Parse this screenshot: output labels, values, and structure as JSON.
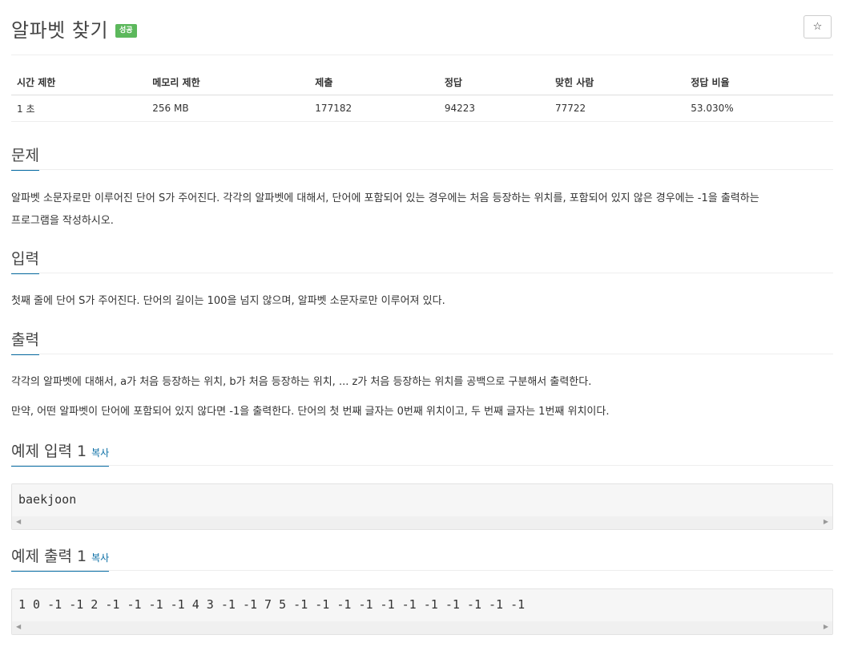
{
  "problem": {
    "title": "알파벳 찾기",
    "status_badge": "성공",
    "star_icon": "☆"
  },
  "stats": {
    "headers": [
      "시간 제한",
      "메모리 제한",
      "제출",
      "정답",
      "맞힌 사람",
      "정답 비율"
    ],
    "values": [
      "1 초",
      "256 MB",
      "177182",
      "94223",
      "77722",
      "53.030%"
    ]
  },
  "sections": {
    "description": {
      "title": "문제",
      "lines": [
        "알파벳 소문자로만 이루어진 단어 S가 주어진다. 각각의 알파벳에 대해서, 단어에 포함되어 있는 경우에는 처음 등장하는 위치를, 포함되어 있지 않은 경우에는 -1을 출력하는",
        "프로그램을 작성하시오."
      ]
    },
    "input": {
      "title": "입력",
      "text": "첫째 줄에 단어 S가 주어진다. 단어의 길이는 100을 넘지 않으며, 알파벳 소문자로만 이루어져 있다."
    },
    "output": {
      "title": "출력",
      "line1": "각각의 알파벳에 대해서, a가 처음 등장하는 위치, b가 처음 등장하는 위치, ... z가 처음 등장하는 위치를 공백으로 구분해서 출력한다.",
      "line2": "만약, 어떤 알파벳이 단어에 포함되어 있지 않다면 -1을 출력한다. 단어의 첫 번째 글자는 0번째 위치이고, 두 번째 글자는 1번째 위치이다."
    },
    "sample_input": {
      "title": "예제 입력 1",
      "copy_label": "복사",
      "content": "baekjoon"
    },
    "sample_output": {
      "title": "예제 출력 1",
      "copy_label": "복사",
      "content": "1 0 -1 -1 2 -1 -1 -1 -1 4 3 -1 -1 7 5 -1 -1 -1 -1 -1 -1 -1 -1 -1 -1 -1"
    }
  },
  "colors": {
    "accent": "#0a6ea5",
    "success": "#5cb85c"
  }
}
